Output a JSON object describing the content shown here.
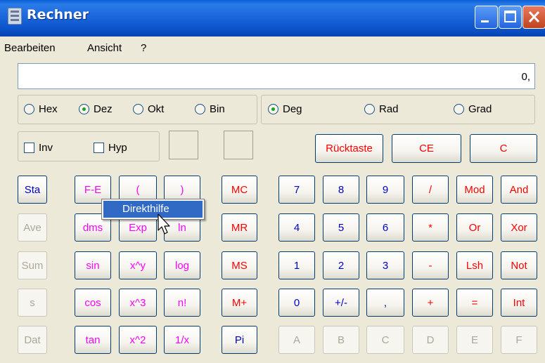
{
  "window": {
    "title": "Rechner",
    "icon": "calculator-icon"
  },
  "menu": [
    "Bearbeiten",
    "Ansicht",
    "?"
  ],
  "display": {
    "value": "0,"
  },
  "number_system": {
    "options": [
      "Hex",
      "Dez",
      "Okt",
      "Bin"
    ],
    "selected": "Dez"
  },
  "angle_unit": {
    "options": [
      "Deg",
      "Rad",
      "Grad"
    ],
    "selected": "Deg"
  },
  "checkboxes": {
    "inv": "Inv",
    "hyp": "Hyp"
  },
  "edit_buttons": {
    "backspace": "Rücktaste",
    "ce": "CE",
    "c": "C"
  },
  "stat_buttons": [
    "Sta",
    "Ave",
    "Sum",
    "s",
    "Dat"
  ],
  "sci_buttons": {
    "col1": [
      "F-E",
      "dms",
      "sin",
      "cos",
      "tan"
    ],
    "col2": [
      "(",
      "Exp",
      "x^y",
      "x^3",
      "x^2"
    ],
    "col3": [
      ")",
      "ln",
      "log",
      "n!",
      "1/x"
    ]
  },
  "memory_buttons": [
    "MC",
    "MR",
    "MS",
    "M+",
    "Pi"
  ],
  "keypad": [
    [
      "7",
      "8",
      "9",
      "/",
      "Mod",
      "And"
    ],
    [
      "4",
      "5",
      "6",
      "*",
      "Or",
      "Xor"
    ],
    [
      "1",
      "2",
      "3",
      "-",
      "Lsh",
      "Not"
    ],
    [
      "0",
      "+/-",
      ",",
      "+",
      "=",
      "Int"
    ],
    [
      "A",
      "B",
      "C",
      "D",
      "E",
      "F"
    ]
  ],
  "context_menu": {
    "item": "Direkthilfe"
  },
  "colors": {
    "titlebar": "#0a52c9",
    "face": "#ece9d8",
    "blue": "#0000cc",
    "red": "#ff0000",
    "magenta": "#ff00ff",
    "disabled": "#aca899",
    "highlight": "#316ac5"
  }
}
